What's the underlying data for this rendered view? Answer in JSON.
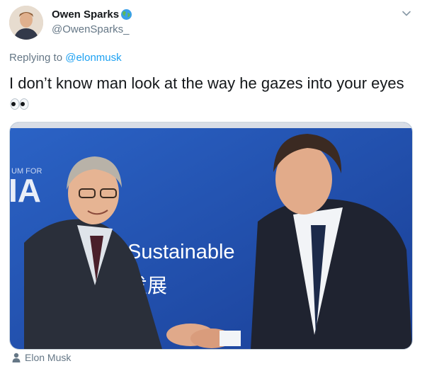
{
  "tweet": {
    "display_name": "Owen Sparks",
    "handle": "@OwenSparks_",
    "replying_prefix": "Replying to ",
    "replying_to": "@elonmusk",
    "text": "I don’t know man look at the way he gazes into your eyes",
    "text_emoji_icon": "eyes-icon"
  },
  "media": {
    "banner_fragment_1": "UM FOR",
    "banner_fragment_2": "IA",
    "banner_text_en": "Sustainable",
    "banner_text_zh": "发展",
    "tagged_user": "Elon Musk"
  },
  "icons": {
    "profile_badge": "globe-icon",
    "menu": "chevron-down-icon",
    "tag": "person-icon"
  },
  "colors": {
    "link": "#1da1f2",
    "secondary_text": "#657786",
    "banner_blue": "#2356b8"
  }
}
